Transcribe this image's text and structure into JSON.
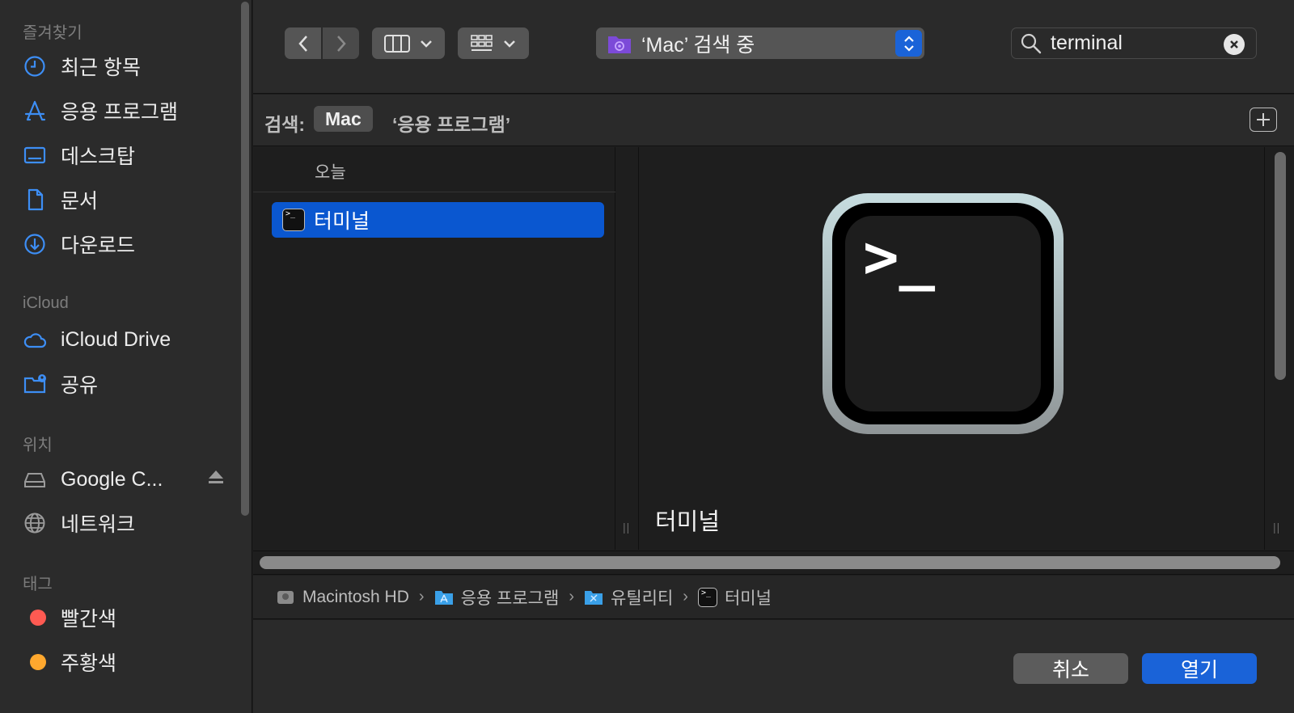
{
  "sidebar": {
    "favorites_title": "즐겨찾기",
    "favorites": [
      {
        "label": "최근 항목",
        "icon": "clock-icon"
      },
      {
        "label": "응용 프로그램",
        "icon": "apps-icon"
      },
      {
        "label": "데스크탑",
        "icon": "desktop-icon"
      },
      {
        "label": "문서",
        "icon": "document-icon"
      },
      {
        "label": "다운로드",
        "icon": "download-icon"
      }
    ],
    "icloud_title": "iCloud",
    "icloud": [
      {
        "label": "iCloud Drive",
        "icon": "cloud-icon"
      },
      {
        "label": "공유",
        "icon": "shared-folder-icon"
      }
    ],
    "locations_title": "위치",
    "locations": [
      {
        "label": "Google C...",
        "icon": "drive-icon"
      },
      {
        "label": "네트워크",
        "icon": "network-icon"
      }
    ],
    "tags_title": "태그",
    "tags": [
      {
        "label": "빨간색",
        "color": "#ff5a52"
      },
      {
        "label": "주황색",
        "color": "#ffa82e"
      }
    ]
  },
  "toolbar": {
    "location": "‘Mac’ 검색 중",
    "search_value": "terminal"
  },
  "scope": {
    "label": "검색:",
    "mac": "Mac",
    "apps": "‘응용 프로그램’"
  },
  "list": {
    "group_header": "오늘",
    "selected_item": "터미널"
  },
  "preview": {
    "name": "터미널",
    "prompt": ">_"
  },
  "path": [
    "Macintosh HD",
    "응용 프로그램",
    "유틸리티",
    "터미널"
  ],
  "buttons": {
    "cancel": "취소",
    "open": "열기"
  },
  "colors": {
    "accent": "#1a63d8",
    "selection": "#0a57d0",
    "sidebar_icon": "#3d8ef5"
  }
}
